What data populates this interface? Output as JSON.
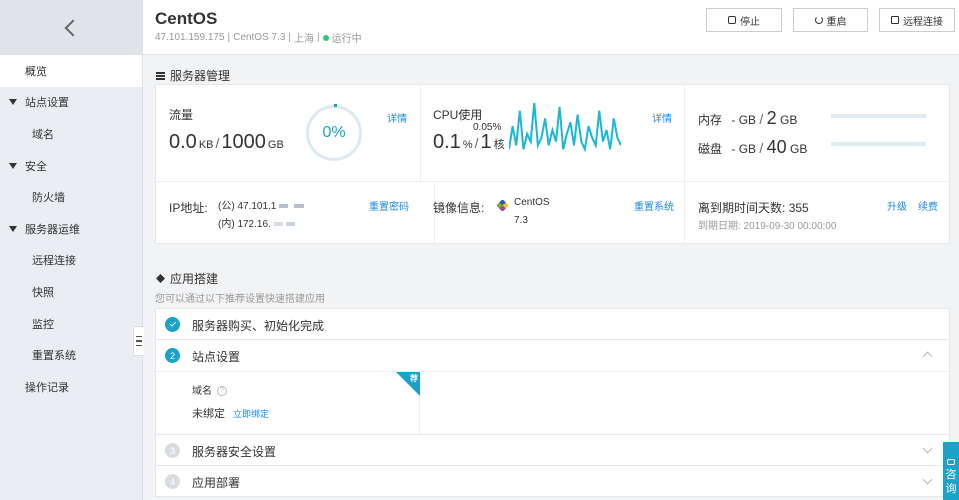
{
  "sidebar": {
    "items": [
      {
        "label": "概览"
      },
      {
        "label": "站点设置"
      },
      {
        "label": "域名"
      },
      {
        "label": "安全"
      },
      {
        "label": "防火墙"
      },
      {
        "label": "服务器运维"
      },
      {
        "label": "远程连接"
      },
      {
        "label": "快照"
      },
      {
        "label": "监控"
      },
      {
        "label": "重置系统"
      },
      {
        "label": "操作记录"
      }
    ]
  },
  "header": {
    "title": "CentOS",
    "ip": "47.101.159.175",
    "os": "CentOS 7.3",
    "region": "上海",
    "status": "运行中",
    "status_color": "#2ecc71",
    "buttons": {
      "stop": "停止",
      "restart": "重启",
      "remote": "远程连接"
    }
  },
  "server": {
    "section_title": "服务器管理",
    "traffic": {
      "label": "流量",
      "used": "0.0",
      "used_unit": "KB",
      "total": "1000",
      "total_unit": "GB",
      "percent": "0%",
      "detail": "详情"
    },
    "cpu": {
      "label": "CPU使用",
      "peak": "0.05%",
      "used": "0.1",
      "used_unit": "%",
      "total": "1",
      "total_unit": "核",
      "detail": "详情"
    },
    "memory": {
      "label": "内存",
      "used": "-",
      "used_unit": "GB",
      "total": "2",
      "total_unit": "GB"
    },
    "disk": {
      "label": "磁盘",
      "used": "-",
      "used_unit": "GB",
      "total": "40",
      "total_unit": "GB"
    },
    "ip": {
      "label": "IP地址:",
      "public": "(公) 47.101.1",
      "private": "(内) 172.16.",
      "reset_pwd": "重置密码"
    },
    "image": {
      "label": "镜像信息:",
      "name": "CentOS",
      "version": "7.3",
      "reset_sys": "重置系统"
    },
    "expire": {
      "label": "离到期时间天数:",
      "days": "355",
      "date": "到期日期: 2019-09-30 00:00:00",
      "upgrade": "升级",
      "renew": "续费"
    }
  },
  "apps": {
    "section_title": "应用搭建",
    "desc": "您可以通过以下推荐设置快速搭建应用",
    "steps": [
      {
        "num": "1",
        "title": "服务器购买、初始化完成"
      },
      {
        "num": "2",
        "title": "站点设置"
      },
      {
        "num": "3",
        "title": "服务器安全设置"
      },
      {
        "num": "4",
        "title": "应用部署"
      }
    ],
    "domain": {
      "label": "域名",
      "help": "?",
      "value": "未绑定",
      "bind": "立即绑定",
      "tag": "荐"
    }
  },
  "consult": {
    "label1": "咨",
    "label2": "询"
  },
  "cpu_series": [
    2,
    8,
    3,
    12,
    2,
    6,
    4,
    14,
    3,
    5,
    10,
    3,
    7,
    4,
    13,
    2,
    6,
    9,
    3,
    11,
    4,
    2,
    8,
    5,
    3,
    12,
    4,
    7,
    2,
    10,
    5,
    3
  ]
}
